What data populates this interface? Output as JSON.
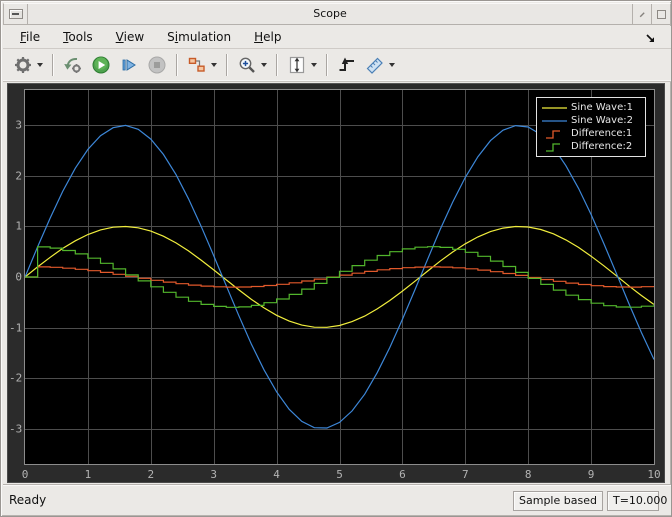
{
  "titlebar": {
    "title": "Scope",
    "buttons": [
      "system-menu-button",
      "restore-button",
      "maximize-button"
    ]
  },
  "menubar": {
    "items": [
      {
        "label": "File",
        "underline": 0
      },
      {
        "label": "Tools",
        "underline": 0
      },
      {
        "label": "View",
        "underline": 0
      },
      {
        "label": "Simulation",
        "underline": 1
      },
      {
        "label": "Help",
        "underline": 0
      }
    ],
    "dock_icon": "dock-arrow-icon"
  },
  "toolbar": {
    "groups": [
      [
        {
          "name": "parameters-button",
          "icon": "gear-icon",
          "dropdown": true
        }
      ],
      [
        {
          "name": "highlight-simulink-block-button",
          "icon": "goto-simulink-icon"
        },
        {
          "name": "run-button",
          "icon": "run-icon"
        },
        {
          "name": "step-forward-button",
          "icon": "step-forward-icon"
        },
        {
          "name": "stop-button",
          "icon": "stop-icon",
          "disabled": true
        }
      ],
      [
        {
          "name": "signal-selector-button",
          "icon": "signal-selector-icon",
          "dropdown": true
        }
      ],
      [
        {
          "name": "zoom-button",
          "icon": "zoom-icon",
          "dropdown": true
        }
      ],
      [
        {
          "name": "axes-scaling-button",
          "icon": "axes-scaling-icon",
          "dropdown": true
        }
      ],
      [
        {
          "name": "trigger-button",
          "icon": "trigger-icon"
        },
        {
          "name": "measurements-button",
          "icon": "measurements-icon",
          "dropdown": true
        }
      ]
    ]
  },
  "statusbar": {
    "status": "Ready",
    "sample_mode": "Sample based",
    "sim_time": "T=10.000"
  },
  "chart_data": {
    "type": "line",
    "title": "",
    "xlabel": "",
    "ylabel": "",
    "xlim": [
      0,
      10
    ],
    "ylim": [
      -3.7,
      3.7
    ],
    "x_ticks": [
      0,
      1,
      2,
      3,
      4,
      5,
      6,
      7,
      8,
      9,
      10
    ],
    "y_ticks": [
      -3,
      -2,
      -1,
      0,
      1,
      2,
      3
    ],
    "grid": true,
    "legend_position": "top-right",
    "axes_background": "#000000",
    "figure_background": "#2b2b2b",
    "grid_color": "#4d4d4d",
    "tick_color": "#b3b3b3",
    "x": [
      0,
      0.2,
      0.4,
      0.6,
      0.8,
      1,
      1.2,
      1.4,
      1.6,
      1.8,
      2,
      2.2,
      2.4,
      2.6,
      2.8,
      3,
      3.2,
      3.4,
      3.6,
      3.8,
      4,
      4.2,
      4.4,
      4.6,
      4.8,
      5,
      5.2,
      5.4,
      5.6,
      5.8,
      6,
      6.2,
      6.4,
      6.6,
      6.8,
      7,
      7.2,
      7.4,
      7.6,
      7.8,
      8,
      8.2,
      8.4,
      8.6,
      8.8,
      9,
      9.2,
      9.4,
      9.6,
      9.8,
      10
    ],
    "series": [
      {
        "name": "Sine Wave:1",
        "color": "#f1ee3d",
        "style": "line",
        "y": [
          0,
          0.199,
          0.389,
          0.565,
          0.717,
          0.841,
          0.932,
          0.985,
          1,
          0.974,
          0.909,
          0.808,
          0.675,
          0.516,
          0.335,
          0.141,
          -0.058,
          -0.256,
          -0.443,
          -0.612,
          -0.757,
          -0.872,
          -0.952,
          -0.994,
          -0.996,
          -0.959,
          -0.883,
          -0.773,
          -0.631,
          -0.465,
          -0.279,
          -0.083,
          0.117,
          0.312,
          0.494,
          0.657,
          0.794,
          0.899,
          0.968,
          0.999,
          0.989,
          0.94,
          0.855,
          0.734,
          0.585,
          0.412,
          0.223,
          0.025,
          -0.174,
          -0.366,
          -0.544
        ]
      },
      {
        "name": "Sine Wave:2",
        "color": "#3d87d8",
        "style": "line",
        "y": [
          0,
          0.596,
          1.168,
          1.694,
          2.152,
          2.524,
          2.796,
          2.955,
          2.999,
          2.923,
          2.728,
          2.425,
          2.026,
          1.547,
          1.005,
          0.423,
          -0.175,
          -0.767,
          -1.329,
          -1.837,
          -2.272,
          -2.617,
          -2.857,
          -2.981,
          -2.988,
          -2.877,
          -2.65,
          -2.319,
          -1.894,
          -1.394,
          -0.838,
          -0.249,
          0.35,
          0.937,
          1.482,
          1.97,
          2.381,
          2.698,
          2.904,
          2.996,
          2.968,
          2.819,
          2.566,
          2.203,
          1.755,
          1.236,
          0.668,
          0.075,
          -0.522,
          -1.098,
          -1.633
        ]
      },
      {
        "name": "Difference:1",
        "color": "#e2592b",
        "style": "stairs",
        "y": [
          0,
          0.199,
          0.191,
          0.175,
          0.153,
          0.124,
          0.091,
          0.053,
          0.014,
          -0.026,
          -0.065,
          -0.101,
          -0.133,
          -0.16,
          -0.181,
          -0.194,
          -0.199,
          -0.197,
          -0.187,
          -0.169,
          -0.145,
          -0.115,
          -0.08,
          -0.042,
          -0.002,
          0.037,
          0.075,
          0.111,
          0.142,
          0.167,
          0.185,
          0.196,
          0.2,
          0.195,
          0.183,
          0.163,
          0.137,
          0.105,
          0.069,
          0.031,
          -0.009,
          -0.049,
          -0.086,
          -0.12,
          -0.149,
          -0.173,
          -0.189,
          -0.198,
          -0.199,
          -0.192,
          -0.178
        ]
      },
      {
        "name": "Difference:2",
        "color": "#52b62c",
        "style": "stairs",
        "y": [
          0,
          0.596,
          0.572,
          0.525,
          0.458,
          0.372,
          0.272,
          0.16,
          0.042,
          -0.077,
          -0.194,
          -0.303,
          -0.4,
          -0.48,
          -0.542,
          -0.582,
          -0.599,
          -0.592,
          -0.561,
          -0.509,
          -0.436,
          -0.345,
          -0.24,
          -0.126,
          -0.007,
          0.112,
          0.226,
          0.332,
          0.425,
          0.5,
          0.555,
          0.589,
          0.599,
          0.585,
          0.548,
          0.489,
          0.41,
          0.315,
          0.207,
          0.092,
          -0.028,
          -0.146,
          -0.259,
          -0.361,
          -0.448,
          -0.518,
          -0.568,
          -0.594,
          -0.597,
          -0.577,
          -0.533
        ]
      }
    ]
  }
}
